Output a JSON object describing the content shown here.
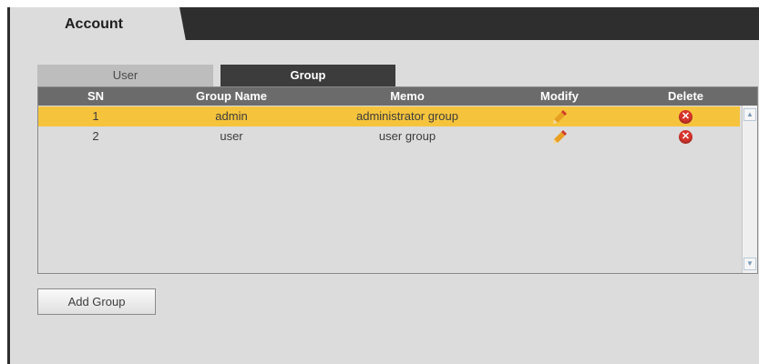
{
  "main_tab": {
    "label": "Account"
  },
  "subtabs": {
    "user": "User",
    "group": "Group"
  },
  "table": {
    "headers": {
      "sn": "SN",
      "group_name": "Group Name",
      "memo": "Memo",
      "modify": "Modify",
      "delete": "Delete"
    },
    "rows": [
      {
        "sn": "1",
        "group_name": "admin",
        "memo": "administrator group",
        "selected": true
      },
      {
        "sn": "2",
        "group_name": "user",
        "memo": "user group",
        "selected": false
      }
    ]
  },
  "buttons": {
    "add_group": "Add Group"
  },
  "colors": {
    "selected_row": "#f5c43c",
    "header_bg": "#6b6b6b",
    "active_subtab": "#3c3c3c",
    "topbar": "#2e2e2e",
    "delete_icon": "#d7352b"
  },
  "icons": {
    "modify": "pencil-icon",
    "delete": "delete-icon"
  }
}
